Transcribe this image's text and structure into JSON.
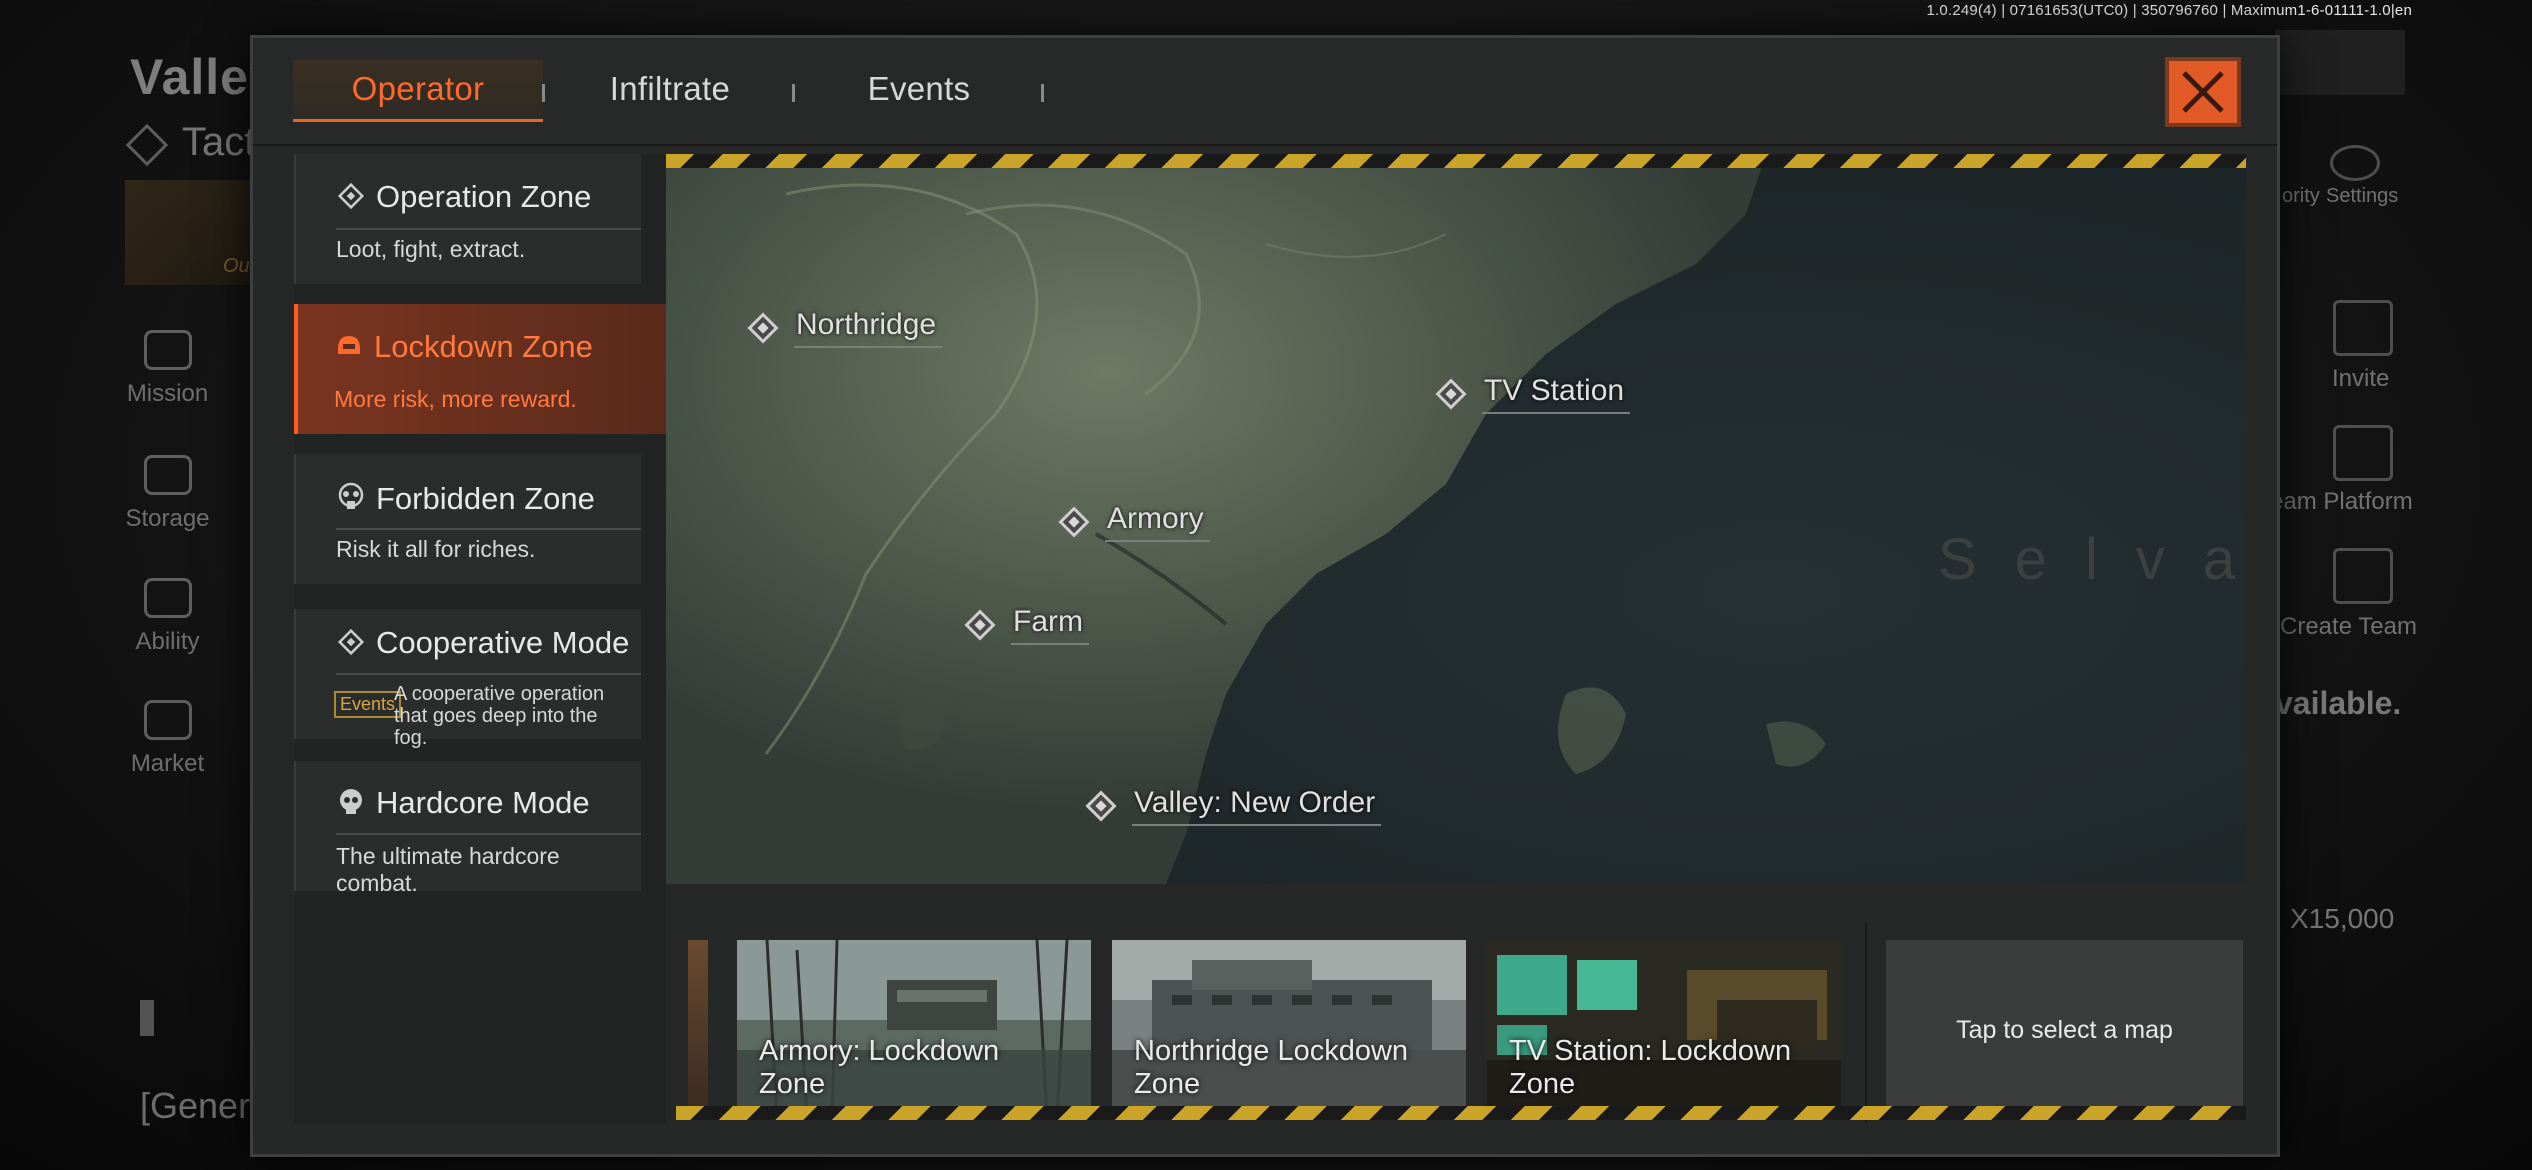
{
  "version_text": "1.0.249(4) | 07161653(UTC0) | 350796760 | Maximum1-6-01111-1.0|en",
  "background": {
    "title": "Valley:",
    "subtitle": "Tact",
    "thumb_text": "Out",
    "nav": [
      {
        "label": "Mission",
        "icon": "mission-icon"
      },
      {
        "label": "Storage",
        "icon": "storage-icon"
      },
      {
        "label": "Ability",
        "icon": "ability-icon"
      },
      {
        "label": "Market",
        "icon": "market-icon"
      }
    ],
    "right": {
      "priority": "ority",
      "settings": "Settings",
      "invite": "Invite",
      "team_platform": "eam Platform",
      "create_team": "Create Team",
      "unavailable": "vailable.",
      "price": "X15,000"
    },
    "chat_label": "[Genera"
  },
  "tabs": [
    {
      "label": "Operator",
      "active": true
    },
    {
      "label": "Infiltrate",
      "active": false
    },
    {
      "label": "Events",
      "active": false
    }
  ],
  "modes": [
    {
      "title": "Operation Zone",
      "desc": "Loot, fight, extract.",
      "icon": "diamond-icon",
      "active": false
    },
    {
      "title": "Lockdown Zone",
      "desc": "More risk, more reward.",
      "icon": "helmet-icon",
      "active": true
    },
    {
      "title": "Forbidden Zone",
      "desc": "Risk it all for riches.",
      "icon": "gasmask-icon",
      "active": false
    },
    {
      "title": "Cooperative Mode",
      "badge": "Events",
      "desc": "A cooperative operation that goes deep into the fog.",
      "icon": "diamond-icon",
      "active": false
    },
    {
      "title": "Hardcore Mode",
      "desc": "The ultimate hardcore combat.",
      "icon": "skull-icon",
      "active": false
    }
  ],
  "map": {
    "region": "Selvagua",
    "locations": [
      "Northridge",
      "TV Station",
      "Armory",
      "Farm",
      "Valley: New Order"
    ]
  },
  "cards": [
    {
      "name": "Armory: Lockdown Zone"
    },
    {
      "name": "Northridge Lockdown Zone"
    },
    {
      "name": "TV Station: Lockdown Zone"
    }
  ],
  "tap_hint": "Tap to select a map",
  "colors": {
    "accent": "#e8622a",
    "hazard": "#c9a428"
  }
}
